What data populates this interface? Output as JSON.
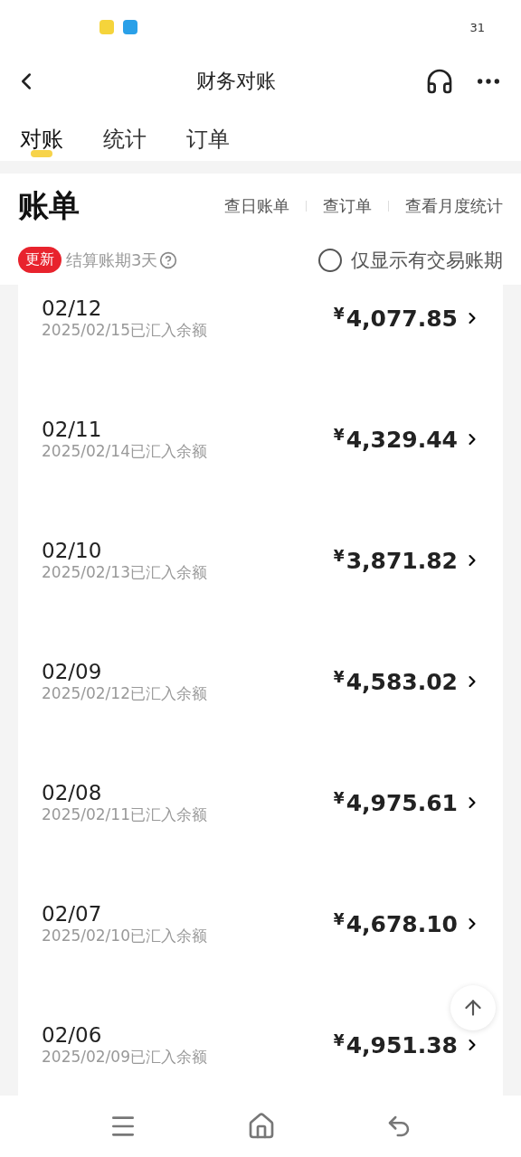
{
  "status_bar": {
    "time": "31"
  },
  "nav": {
    "title": "财务对账"
  },
  "tabs": [
    {
      "label": "对账",
      "selected": true
    },
    {
      "label": "统计",
      "selected": false
    },
    {
      "label": "订单",
      "selected": false
    }
  ],
  "section": {
    "title": "账单",
    "links": [
      "查日账单",
      "查订单",
      "查看月度统计"
    ],
    "badge": "更新",
    "period": "结算账期3天",
    "filter": {
      "label": "仅显示有交易账期",
      "checked": false
    }
  },
  "bills": [
    {
      "date": "02/12",
      "note": "2025/02/15已汇入余额",
      "currency": "¥",
      "amount": "4,077.85"
    },
    {
      "date": "02/11",
      "note": "2025/02/14已汇入余额",
      "currency": "¥",
      "amount": "4,329.44"
    },
    {
      "date": "02/10",
      "note": "2025/02/13已汇入余额",
      "currency": "¥",
      "amount": "3,871.82"
    },
    {
      "date": "02/09",
      "note": "2025/02/12已汇入余额",
      "currency": "¥",
      "amount": "4,583.02"
    },
    {
      "date": "02/08",
      "note": "2025/02/11已汇入余额",
      "currency": "¥",
      "amount": "4,975.61"
    },
    {
      "date": "02/07",
      "note": "2025/02/10已汇入余额",
      "currency": "¥",
      "amount": "4,678.10"
    },
    {
      "date": "02/06",
      "note": "2025/02/09已汇入余额",
      "currency": "¥",
      "amount": "4,951.38"
    }
  ]
}
